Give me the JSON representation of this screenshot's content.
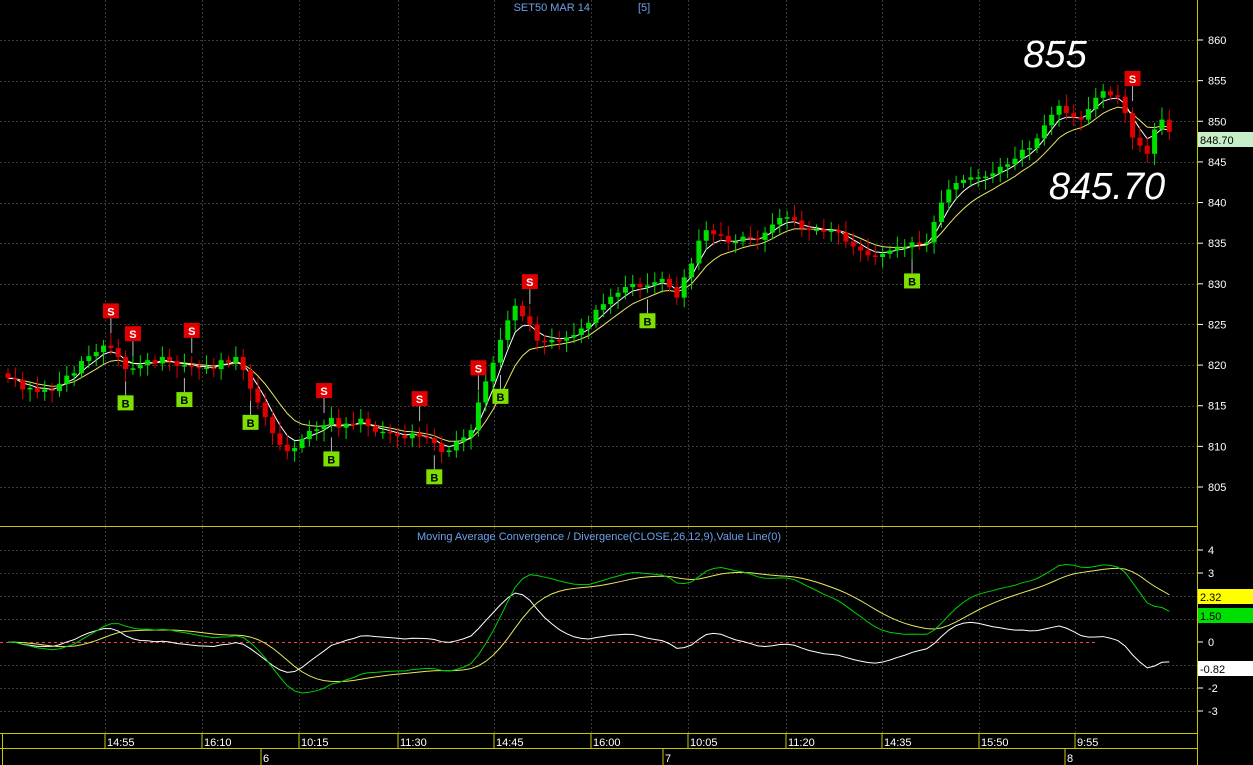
{
  "title": "SET50 MAR 14",
  "title_interval": "[5]",
  "colors": {
    "background": "#000000",
    "grid": "#3a3a3a",
    "frame": "#c8c800",
    "up_candle": "#00e000",
    "down_candle": "#e00000",
    "ma_fast": "#ffffff",
    "ma_slow": "#e8e860",
    "buy_signal": "#7ee000",
    "sell_signal": "#e00000",
    "axis_text": "#ffffff",
    "title_text": "#6ea0e8",
    "macd_line": "#00d000",
    "signal_line": "#e8e860",
    "histogram_line": "#ffffff",
    "zero_line": "#ff4040"
  },
  "annotations": {
    "high": "855",
    "low": "845.70"
  },
  "price_axis": {
    "ticks": [
      "805",
      "810",
      "815",
      "820",
      "825",
      "830",
      "835",
      "840",
      "845",
      "850",
      "855",
      "860"
    ],
    "last_price": "848.70"
  },
  "time_axis": {
    "ticks": [
      "14:55",
      "16:10",
      "10:15",
      "11:30",
      "14:45",
      "16:00",
      "10:05",
      "11:20",
      "14:35",
      "15:50",
      "9:55"
    ],
    "days": [
      "6",
      "7",
      "8"
    ]
  },
  "macd_panel": {
    "title": "Moving Average Convergence / Divergence(CLOSE,26,12,9),Value Line(0)",
    "ticks": [
      "4",
      "3",
      "2",
      "1",
      "0",
      "-1",
      "-2",
      "-3"
    ],
    "value_badges": [
      "2.32",
      "1.50",
      "-0.82"
    ]
  },
  "chart_data": {
    "type": "candlestick",
    "title": "SET50 MAR 14 [5]",
    "price_ylim": [
      800,
      865
    ],
    "macd_ylim": [
      -4,
      5
    ],
    "candles": [
      [
        819.0,
        818.4
      ],
      [
        818.4,
        818.2
      ],
      [
        818.2,
        817.0
      ],
      [
        817.0,
        817.2
      ],
      [
        817.2,
        816.7
      ],
      [
        816.7,
        817.0
      ],
      [
        817.0,
        816.8
      ],
      [
        816.8,
        817.7
      ],
      [
        817.7,
        818.7
      ],
      [
        818.7,
        819.0
      ],
      [
        819.0,
        820.5
      ],
      [
        820.5,
        821.1
      ],
      [
        821.1,
        821.6
      ],
      [
        821.6,
        822.4
      ],
      [
        822.4,
        822.1
      ],
      [
        822.1,
        821.0
      ],
      [
        821.0,
        819.5
      ],
      [
        819.5,
        819.6
      ],
      [
        819.6,
        820.0
      ],
      [
        820.0,
        820.6
      ],
      [
        820.6,
        820.2
      ],
      [
        820.2,
        821.0
      ],
      [
        821.0,
        820.5
      ],
      [
        820.5,
        819.9
      ],
      [
        819.9,
        820.0
      ],
      [
        820.0,
        819.8
      ],
      [
        819.8,
        819.6
      ],
      [
        819.6,
        819.7
      ],
      [
        819.7,
        819.5
      ],
      [
        819.5,
        820.6
      ],
      [
        820.6,
        820.3
      ],
      [
        820.3,
        821.0
      ],
      [
        821.0,
        819.4
      ],
      [
        819.4,
        817.1
      ],
      [
        817.1,
        815.4
      ],
      [
        815.4,
        813.6
      ],
      [
        813.6,
        811.6
      ],
      [
        811.6,
        810.2
      ],
      [
        810.2,
        809.4
      ],
      [
        809.4,
        809.8
      ],
      [
        809.8,
        810.9
      ],
      [
        810.9,
        811.9
      ],
      [
        811.9,
        812.1
      ],
      [
        812.1,
        812.6
      ],
      [
        812.6,
        813.5
      ],
      [
        813.5,
        812.3
      ],
      [
        812.3,
        812.8
      ],
      [
        812.8,
        812.7
      ],
      [
        812.7,
        813.4
      ],
      [
        813.4,
        812.5
      ],
      [
        812.5,
        811.8
      ],
      [
        811.8,
        811.8
      ],
      [
        811.8,
        811.6
      ],
      [
        811.6,
        811.3
      ],
      [
        811.3,
        811.0
      ],
      [
        811.0,
        811.6
      ],
      [
        811.6,
        811.2
      ],
      [
        811.2,
        811.0
      ],
      [
        811.0,
        810.4
      ],
      [
        810.4,
        809.3
      ],
      [
        809.3,
        809.5
      ],
      [
        809.5,
        810.6
      ],
      [
        810.6,
        811.1
      ],
      [
        811.1,
        812.0
      ],
      [
        812.0,
        815.4
      ],
      [
        815.4,
        818.0
      ],
      [
        818.0,
        820.3
      ],
      [
        820.3,
        823.1
      ],
      [
        823.1,
        825.5
      ],
      [
        825.5,
        827.3
      ],
      [
        827.3,
        826.0
      ],
      [
        826.0,
        825.0
      ],
      [
        825.0,
        823.0
      ],
      [
        823.0,
        822.8
      ],
      [
        822.8,
        823.1
      ],
      [
        823.1,
        823.0
      ],
      [
        823.0,
        823.4
      ],
      [
        823.4,
        823.7
      ],
      [
        823.7,
        824.5
      ],
      [
        824.5,
        825.2
      ],
      [
        825.2,
        826.8
      ],
      [
        826.8,
        827.5
      ],
      [
        827.5,
        828.4
      ],
      [
        828.4,
        828.9
      ],
      [
        828.9,
        829.6
      ],
      [
        829.6,
        830.0
      ],
      [
        830.0,
        829.6
      ],
      [
        829.6,
        829.8
      ],
      [
        829.8,
        830.2
      ],
      [
        830.2,
        830.6
      ],
      [
        830.6,
        829.6
      ],
      [
        829.6,
        828.3
      ],
      [
        828.3,
        830.8
      ],
      [
        830.8,
        832.5
      ],
      [
        832.5,
        835.3
      ],
      [
        835.3,
        836.6
      ],
      [
        836.6,
        836.1
      ],
      [
        836.1,
        835.9
      ],
      [
        835.9,
        835.1
      ],
      [
        835.1,
        835.2
      ],
      [
        835.2,
        835.8
      ],
      [
        835.8,
        835.6
      ],
      [
        835.6,
        835.4
      ],
      [
        835.4,
        836.3
      ],
      [
        836.3,
        837.3
      ],
      [
        837.3,
        838.1
      ],
      [
        838.1,
        838.2
      ],
      [
        838.2,
        837.8
      ],
      [
        837.8,
        836.8
      ],
      [
        836.8,
        836.6
      ],
      [
        836.6,
        836.7
      ],
      [
        836.7,
        836.4
      ],
      [
        836.4,
        836.6
      ],
      [
        836.6,
        836.3
      ],
      [
        836.3,
        835.2
      ],
      [
        835.2,
        834.6
      ],
      [
        834.6,
        834.1
      ],
      [
        834.1,
        833.5
      ],
      [
        833.5,
        833.3
      ],
      [
        833.3,
        833.7
      ],
      [
        833.7,
        834.1
      ],
      [
        834.1,
        834.5
      ],
      [
        834.5,
        834.5
      ],
      [
        834.5,
        835.1
      ],
      [
        835.1,
        835.0
      ],
      [
        835.0,
        835.1
      ],
      [
        835.1,
        837.6
      ],
      [
        837.6,
        840.0
      ],
      [
        840.0,
        841.6
      ],
      [
        841.6,
        842.4
      ],
      [
        842.4,
        842.8
      ],
      [
        842.8,
        843.1
      ],
      [
        843.1,
        843.1
      ],
      [
        843.1,
        843.2
      ],
      [
        843.2,
        843.6
      ],
      [
        843.6,
        844.4
      ],
      [
        844.4,
        844.7
      ],
      [
        844.7,
        845.4
      ],
      [
        845.4,
        846.5
      ],
      [
        846.5,
        846.7
      ],
      [
        846.7,
        847.9
      ],
      [
        847.9,
        849.5
      ],
      [
        849.5,
        850.8
      ],
      [
        850.8,
        851.9
      ],
      [
        851.9,
        851.0
      ],
      [
        851.0,
        850.5
      ],
      [
        850.5,
        850.2
      ],
      [
        850.2,
        851.5
      ],
      [
        851.5,
        852.9
      ],
      [
        852.9,
        853.7
      ],
      [
        853.7,
        853.2
      ],
      [
        853.2,
        853.0
      ],
      [
        853.0,
        851.0
      ],
      [
        851.0,
        848.0
      ],
      [
        848.0,
        847.0
      ],
      [
        847.0,
        846.0
      ],
      [
        846.0,
        849.0
      ],
      [
        849.0,
        850.2
      ],
      [
        850.2,
        848.7
      ]
    ],
    "buy_signals": [
      16,
      24,
      33,
      44,
      58,
      67,
      87,
      123
    ],
    "sell_signals": [
      14,
      17,
      25,
      43,
      56,
      64,
      71,
      153
    ],
    "macd_lines_note": "MACD line, signal line and histogram line plotted in lower panel"
  }
}
